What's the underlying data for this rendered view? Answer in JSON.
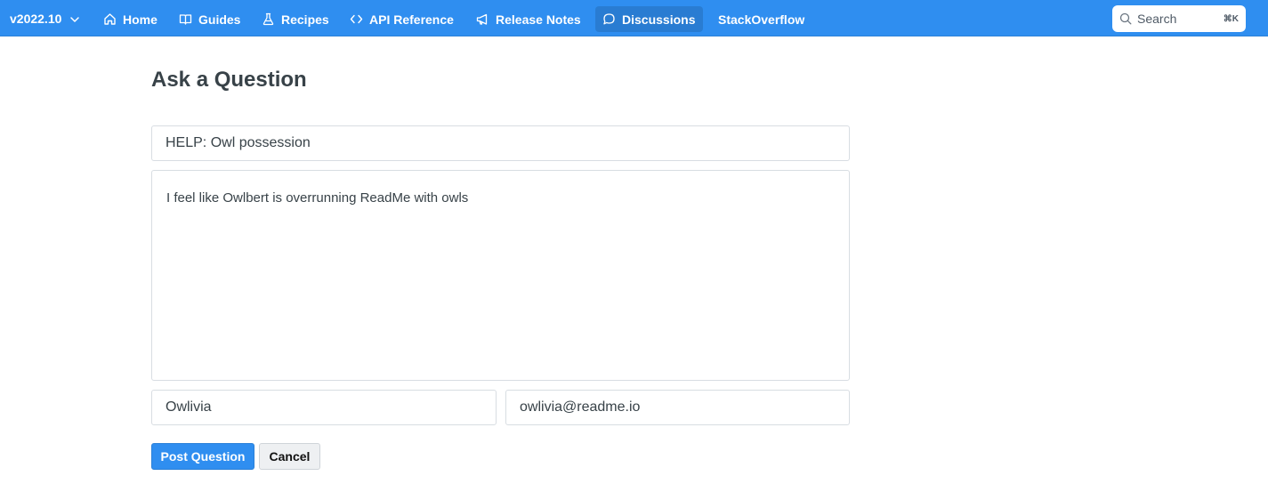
{
  "nav": {
    "version": "v2022.10",
    "items": [
      {
        "label": "Home",
        "icon": "home-icon"
      },
      {
        "label": "Guides",
        "icon": "book-icon"
      },
      {
        "label": "Recipes",
        "icon": "flask-icon"
      },
      {
        "label": "API Reference",
        "icon": "code-icon"
      },
      {
        "label": "Release Notes",
        "icon": "megaphone-icon"
      },
      {
        "label": "Discussions",
        "icon": "chat-bubble-icon",
        "active": true
      },
      {
        "label": "StackOverflow"
      }
    ],
    "search": {
      "label": "Search",
      "shortcut": "⌘K",
      "icon": "search-icon"
    }
  },
  "page": {
    "title": "Ask a Question"
  },
  "form": {
    "question_title": "HELP: Owl possession",
    "question_body": "I feel like Owlbert is overrunning ReadMe with owls",
    "name": "Owlivia",
    "email": "owlivia@readme.io",
    "post_label": "Post Question",
    "cancel_label": "Cancel"
  },
  "colors": {
    "brand": "#2f8ef0",
    "text": "#384248",
    "border": "#d8dde2"
  }
}
